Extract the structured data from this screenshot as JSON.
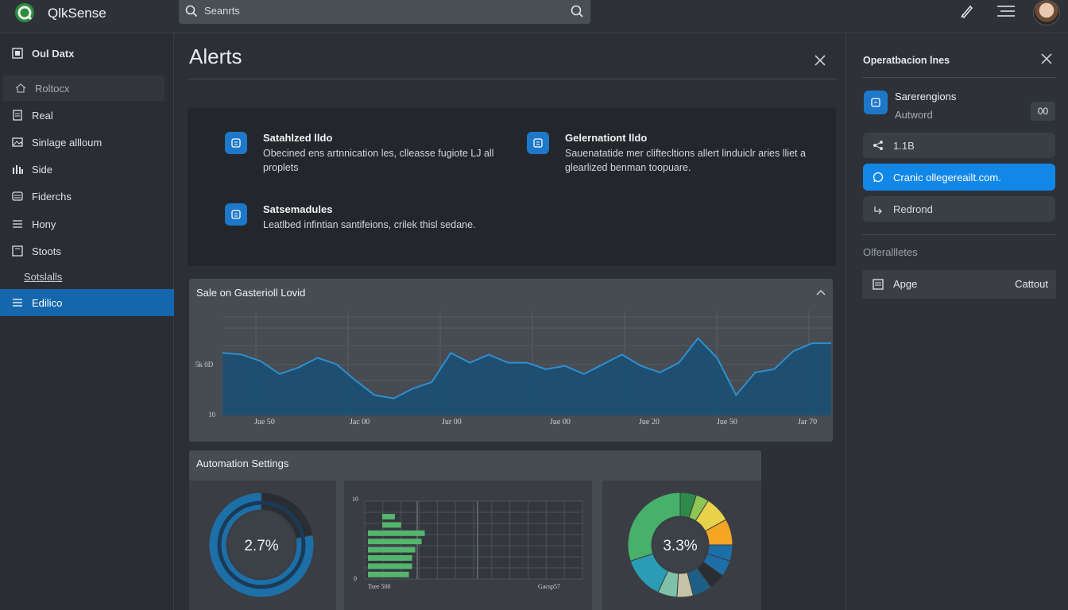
{
  "app": {
    "brand": "QlkSense"
  },
  "search": {
    "placeholder": "Seanrts"
  },
  "sidebar": {
    "header": "Oul Datx",
    "items": [
      {
        "label": "Roltocx",
        "icon": "home-icon"
      },
      {
        "label": "Real",
        "icon": "document-icon"
      },
      {
        "label": "Sinlage allloum",
        "icon": "image-icon"
      },
      {
        "label": "Side",
        "icon": "bars-icon"
      },
      {
        "label": "Fiderchs",
        "icon": "layers-icon"
      },
      {
        "label": "Hony",
        "icon": "list-icon"
      },
      {
        "label": "Stoots",
        "icon": "window-icon"
      }
    ],
    "sub_link": "Sotslalls",
    "active_item": {
      "label": "Edilico",
      "icon": "list-icon"
    }
  },
  "main": {
    "title": "Alerts",
    "alerts": [
      {
        "title": "Satahlzed lldo",
        "desc": "Obecined ens artnnication les, clleasse fugiote LJ all proplets"
      },
      {
        "title": "Gelernationt lldo",
        "desc": "Sauenatatide mer cliftecltions allert linduiclr aries lliet a glearlized benman toopuare."
      },
      {
        "title": "Satsemadules",
        "desc": "Leatlbed infintian santifeions, crilek thisl sedane."
      }
    ]
  },
  "chart_card": {
    "title": "Sale on Gasterioll Lovid"
  },
  "chart_data": [
    {
      "type": "area",
      "title": "Sale on Gasterioll Lovid",
      "y_tick_labels": [
        "5k 0D",
        "10"
      ],
      "x_tick_labels": [
        "Jue 50",
        "Jac 00",
        "Jur 00",
        "Jue 00",
        "Jue 20",
        "Jue 50",
        "Jar 70"
      ],
      "values": [
        58,
        57,
        53,
        45,
        49,
        55,
        51,
        41,
        32,
        30,
        36,
        40,
        58,
        52,
        57,
        52,
        52,
        48,
        50,
        45,
        51,
        57,
        50,
        46,
        52,
        67,
        55,
        32,
        46,
        48,
        59,
        64,
        64
      ],
      "ylim": [
        0,
        100
      ],
      "grid": true
    },
    {
      "type": "pie",
      "center_label": "2.7%",
      "values": [
        22,
        78
      ],
      "colors": [
        "#2a2e33",
        "#1d6fa8"
      ]
    },
    {
      "type": "bar",
      "orientation": "horizontal",
      "y_tick_labels": [
        "10",
        "0"
      ],
      "x_tick_labels": [
        "Tsee 500",
        "Gacsp57"
      ],
      "values": [
        4,
        6,
        18,
        17,
        15,
        14,
        14,
        13
      ],
      "xlim": [
        0,
        100
      ]
    },
    {
      "type": "pie",
      "center_label": "3.3%",
      "values": [
        5,
        4,
        8,
        8,
        5,
        5,
        5,
        6,
        5,
        6,
        13,
        30
      ],
      "colors": [
        "#2f8a4a",
        "#8dc653",
        "#e8d24a",
        "#f4a524",
        "#1d6fa8",
        "#1d6fa8",
        "#2a2e33",
        "#1f5f85",
        "#c7c3a9",
        "#7fc1a8",
        "#2a9db5",
        "#47b06a"
      ]
    }
  ],
  "automation": {
    "title": "Automation Settings"
  },
  "right_panel": {
    "title": "Operatbacion lnes",
    "profile": {
      "name": "Sarerengions",
      "sub": "Autword",
      "badge": "00"
    },
    "rows": [
      {
        "label": "1.1B",
        "icon": "share-icon"
      },
      {
        "label": "Cranic ollegereailt.com.",
        "icon": "whatsapp-icon"
      },
      {
        "label": "Redrond",
        "icon": "redo-icon"
      }
    ],
    "section": "Olferallletes",
    "item": {
      "label": "Apge",
      "value": "Cattout"
    }
  },
  "colors": {
    "accent": "#1467ad",
    "primary_button": "#1187e8",
    "chart_fill": "#1c4f72",
    "chart_line": "#2e8fd0",
    "bar_green": "#55b46e"
  }
}
